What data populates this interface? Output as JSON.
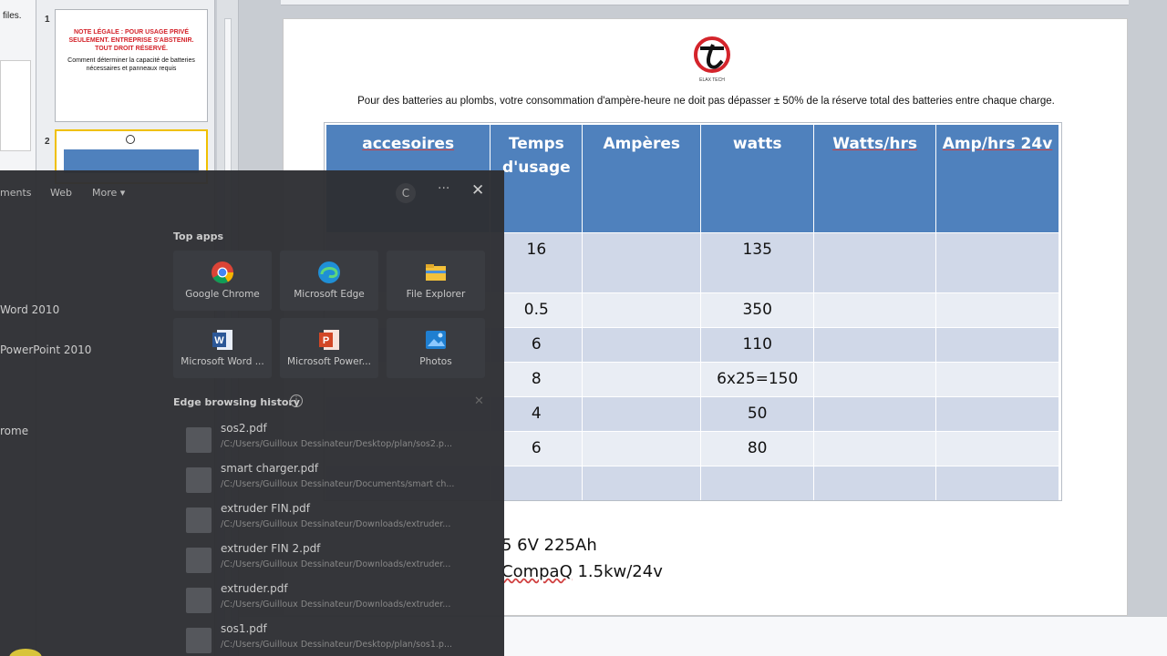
{
  "ppt": {
    "left_fragment": "files.",
    "slide_numbers": [
      "1",
      "2"
    ],
    "thumb1": {
      "red_text": "NOTE LÉGALE : POUR USAGE PRIVÉ SEULEMENT. ENTREPRISE S'ABSTENIR. TOUT DROIT RÉSERVÉ.",
      "black_text": "Comment déterminer la capacité de batteries nécessaires et panneaux requis"
    },
    "slide": {
      "logo_caption": "ELAX TECH",
      "intro_text": "Pour des batteries au plombs, votre consommation d'ampère-heure ne doit pas dépasser ± 50% de la réserve total des batteries entre chaque charge.",
      "table": {
        "headers": [
          "accesoires",
          "Temps d'usage",
          "Ampères",
          "watts",
          "Watts/hrs",
          "Amp/hrs 24v"
        ],
        "rows": [
          [
            "",
            "16",
            "",
            "135",
            "",
            ""
          ],
          [
            "",
            "0.5",
            "",
            "350",
            "",
            ""
          ],
          [
            "",
            "6",
            "",
            "110",
            "",
            ""
          ],
          [
            "",
            "8",
            "",
            "6x25=150",
            "",
            ""
          ],
          [
            "",
            "4",
            "",
            "50",
            "",
            ""
          ],
          [
            "",
            "6",
            "",
            "80",
            "",
            ""
          ],
          [
            "",
            "",
            "",
            "",
            "",
            ""
          ]
        ]
      },
      "note1": "5 6V 225Ah",
      "note2_word": "CompaQ",
      "note2_rest": " 1.5kw/24v"
    }
  },
  "search": {
    "tabs": {
      "documents": "ments",
      "web": "Web",
      "more": "More ▾"
    },
    "header": {
      "c": "C",
      "dots": "···",
      "close": "✕"
    },
    "recent": [
      "Word 2010",
      "PowerPoint 2010",
      "rome"
    ],
    "top_apps_title": "Top apps",
    "top_apps": [
      {
        "label": "Google Chrome",
        "icon": "chrome-icon"
      },
      {
        "label": "Microsoft Edge",
        "icon": "edge-icon"
      },
      {
        "label": "File Explorer",
        "icon": "file-explorer-icon"
      },
      {
        "label": "Microsoft Word ...",
        "icon": "word-icon"
      },
      {
        "label": "Microsoft Power...",
        "icon": "powerpoint-icon"
      },
      {
        "label": "Photos",
        "icon": "photos-icon"
      }
    ],
    "history_title": "Edge browsing history",
    "history_info": "i",
    "history_close": "✕",
    "history": [
      {
        "name": "sos2.pdf",
        "path": "/C:/Users/Guilloux Dessinateur/Desktop/plan/sos2.p..."
      },
      {
        "name": "smart charger.pdf",
        "path": "/C:/Users/Guilloux Dessinateur/Documents/smart ch..."
      },
      {
        "name": "extruder FIN.pdf",
        "path": "/C:/Users/Guilloux Dessinateur/Downloads/extruder..."
      },
      {
        "name": "extruder FIN 2.pdf",
        "path": "/C:/Users/Guilloux Dessinateur/Downloads/extruder..."
      },
      {
        "name": "extruder.pdf",
        "path": "/C:/Users/Guilloux Dessinateur/Downloads/extruder..."
      },
      {
        "name": "sos1.pdf",
        "path": "/C:/Users/Guilloux Dessinateur/Desktop/plan/sos1.p..."
      }
    ]
  }
}
